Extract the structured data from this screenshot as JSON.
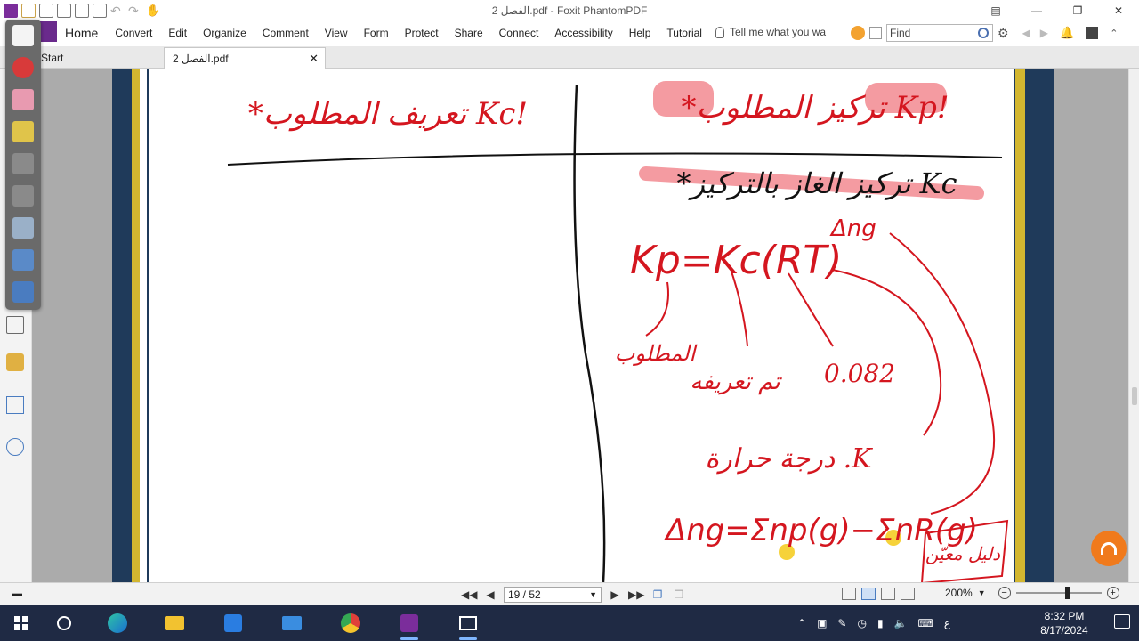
{
  "window": {
    "title": "الفصل 2.pdf - Foxit PhantomPDF"
  },
  "ribbon": {
    "tabs": [
      "Home",
      "Convert",
      "Edit",
      "Organize",
      "Comment",
      "View",
      "Form",
      "Protect",
      "Share",
      "Connect",
      "Accessibility",
      "Help",
      "Tutorial"
    ],
    "tell_me": "Tell me what you wa",
    "find_placeholder": "Find"
  },
  "doc_tabs": {
    "start": "Start",
    "current": "الفصل 2.pdf"
  },
  "navigation": {
    "page_field": "19 / 52",
    "zoom": "200%"
  },
  "taskbar": {
    "lang": "ع",
    "time": "8:32 PM",
    "date": "8/17/2024"
  },
  "page_notes": {
    "left_heading": "*تعريف المطلوب Kc!",
    "right_heading": "*تركيز المطلوب Kp!",
    "right_subheading": "*تركيز الغاز بالتركيز Kc",
    "formula": "Kp=Kc(RT)",
    "exponent": "Δng",
    "label_kp_target": "المطلوب",
    "label_kc": "تم تعريفه",
    "label_r": "0.082",
    "label_t": "درجة حرارة .K",
    "formula2": "Δng=Σnp(g)−ΣnR(g)",
    "box_note": "دليل معيّن"
  },
  "colors": {
    "ink_red": "#d4161f",
    "highlight_pink": "#f28a91",
    "highlight_yellow": "#f6d23a",
    "border_navy": "#1f3a5a",
    "border_gold": "#d2b630"
  }
}
